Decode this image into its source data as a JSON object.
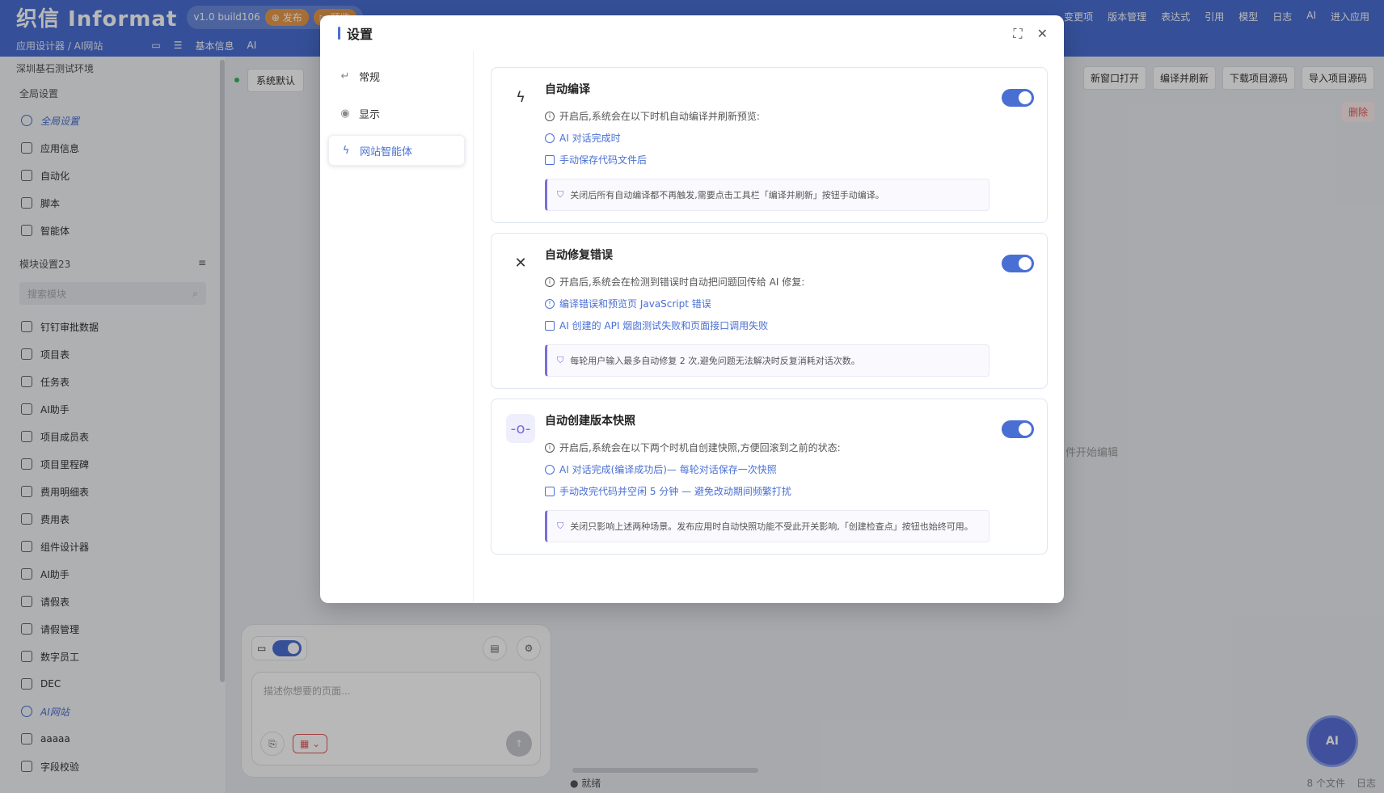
{
  "header": {
    "logo": "织信 Informat",
    "version": "v1.0 build106",
    "publish": "发布",
    "preview": "预览",
    "right_items": [
      "变更项",
      "版本管理",
      "表达式",
      "引用",
      "模型",
      "日志",
      "AI",
      "进入应用"
    ],
    "breadcrumb": "应用设计器 / AI网站",
    "sub_tabs": [
      "基本信息",
      "AI"
    ]
  },
  "sidebar": {
    "env": "深圳基石测试环境",
    "global_section": "全局设置",
    "global_items": [
      {
        "label": "全局设置",
        "active": true
      },
      {
        "label": "应用信息"
      },
      {
        "label": "自动化"
      },
      {
        "label": "脚本"
      },
      {
        "label": "智能体"
      }
    ],
    "module_section": "模块设置23",
    "search_placeholder": "搜索模块",
    "modules": [
      {
        "label": "钉钉审批数据"
      },
      {
        "label": "项目表"
      },
      {
        "label": "任务表"
      },
      {
        "label": "AI助手"
      },
      {
        "label": "项目成员表"
      },
      {
        "label": "项目里程碑"
      },
      {
        "label": "费用明细表"
      },
      {
        "label": "费用表"
      },
      {
        "label": "组件设计器"
      },
      {
        "label": "AI助手"
      },
      {
        "label": "请假表"
      },
      {
        "label": "请假管理"
      },
      {
        "label": "数字员工"
      },
      {
        "label": "DEC"
      },
      {
        "label": "AI网站",
        "active": true
      },
      {
        "label": "aaaaa"
      },
      {
        "label": "字段校验"
      }
    ]
  },
  "main": {
    "env_select": "系统默认",
    "tools": [
      "新窗口打开",
      "编译并刷新",
      "下载项目源码",
      "导入项目源码"
    ],
    "delete": "删除",
    "hint": "件开始编辑",
    "chat_placeholder": "描述你想要的页面...",
    "status": "就绪",
    "file_count": "8 个文件",
    "log": "日志",
    "ai_badge": "AI"
  },
  "modal": {
    "title": "设置",
    "nav": [
      {
        "label": "常规",
        "icon": "↵"
      },
      {
        "label": "显示",
        "icon": "◉"
      },
      {
        "label": "网站智能体",
        "icon": "ϟ",
        "active": true
      }
    ],
    "cards": [
      {
        "icon": "ϟ",
        "title": "自动编译",
        "desc": "开启后,系统会在以下时机自动编译并刷新预览:",
        "links": [
          "AI 对话完成时",
          "手动保存代码文件后"
        ],
        "note": "关闭后所有自动编译都不再触发,需要点击工具栏「编译并刷新」按钮手动编译。",
        "enabled": true
      },
      {
        "icon": "✕",
        "title": "自动修复错误",
        "desc": "开启后,系统会在检测到错误时自动把问题回传给 AI 修复:",
        "links": [
          "编译错误和预览页 JavaScript 错误",
          "AI 创建的 API 烟囱测试失败和页面接口调用失败"
        ],
        "note": "每轮用户输入最多自动修复 2 次,避免问题无法解决时反复消耗对话次数。",
        "enabled": true
      },
      {
        "icon": "-o-",
        "title": "自动创建版本快照",
        "desc": "开启后,系统会在以下两个时机自创建快照,方便回滚到之前的状态:",
        "links": [
          "AI 对话完成(编译成功后)— 每轮对话保存一次快照",
          "手动改完代码并空闲 5 分钟 — 避免改动期间频繁打扰"
        ],
        "note": "关闭只影响上述两种场景。发布应用时自动快照功能不受此开关影响,「创建检查点」按钮也始终可用。",
        "enabled": true
      }
    ]
  }
}
